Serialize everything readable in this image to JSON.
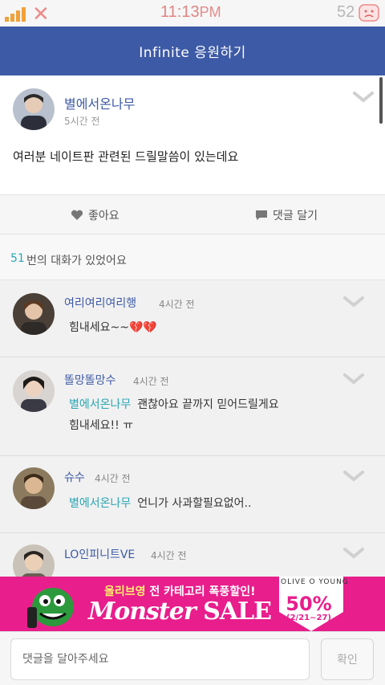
{
  "status_bar": {
    "time": "11:13",
    "ampm": "PM",
    "battery": "52"
  },
  "header": {
    "title": "Infinite 응원하기"
  },
  "post": {
    "author": "별에서온나무",
    "time": "5시간 전",
    "body": "여러분 네이트판 관련된 드릴말씀이 있는데요"
  },
  "actions": {
    "like": "좋아요",
    "comment": "댓글 달기"
  },
  "conversation": {
    "count": "51",
    "suffix": "번의 대화가 있었어요"
  },
  "comments": [
    {
      "name": "여리여리여리행",
      "time": "4시간 전",
      "mention": "",
      "text": "힘내세요~~💔💔"
    },
    {
      "name": "똘망똘망수",
      "time": "4시간 전",
      "mention": "별에서온나무",
      "text": "괜찮아요 끝까지 믿어드릴게요",
      "text2": "힘내세요!! ㅠ"
    },
    {
      "name": "슈수",
      "time": "4시간 전",
      "mention": "별에서온나무",
      "text": "언니가 사과할필요없어.."
    },
    {
      "name": "LO인피니트VE",
      "time": "4시간 전",
      "mention": "",
      "text": ""
    }
  ],
  "ad": {
    "brand": "올리브영",
    "headline": "전 카테고리 폭풍할인!",
    "sale_a": "Monster",
    "sale_b": "SALE",
    "logo": "OLIVE O YOUNG",
    "percent": "50%",
    "dates": "(2/21~27)"
  },
  "input": {
    "placeholder": "댓글을 달아주세요",
    "confirm": "확인"
  },
  "colors": {
    "header": "#3d5aa6",
    "accent": "#2aa6b5",
    "ad": "#e81e8c"
  }
}
